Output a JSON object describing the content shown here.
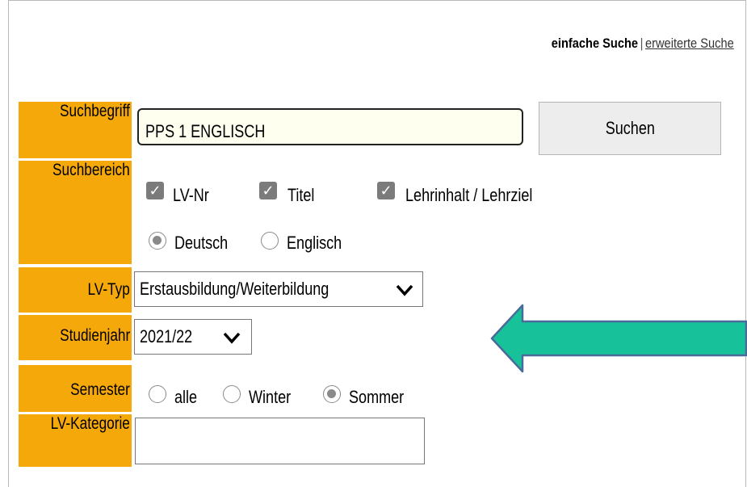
{
  "top_links": {
    "simple_search": "einfache Suche",
    "separator": "|",
    "advanced_search": "erweiterte Suche"
  },
  "labels": {
    "suchbegriff": "Suchbegriff",
    "suchbereich": "Suchbereich",
    "lv_typ": "LV-Typ",
    "studienjahr": "Studienjahr",
    "semester": "Semester",
    "lv_kategorie": "LV-Kategorie"
  },
  "search": {
    "value": "PPS 1 ENGLISCH",
    "button_label": "Suchen"
  },
  "suchbereich": {
    "checkboxes": [
      {
        "label": "LV-Nr",
        "checked": true
      },
      {
        "label": "Titel",
        "checked": true
      },
      {
        "label": "Lehrinhalt / Lehrziel",
        "checked": true
      }
    ],
    "language": [
      {
        "label": "Deutsch",
        "selected": true
      },
      {
        "label": "Englisch",
        "selected": false
      }
    ]
  },
  "lv_typ": {
    "selected": "Erstausbildung/Weiterbildung"
  },
  "studienjahr": {
    "selected": "2021/22"
  },
  "semester": [
    {
      "label": "alle",
      "selected": false
    },
    {
      "label": "Winter",
      "selected": false
    },
    {
      "label": "Sommer",
      "selected": true
    }
  ],
  "lv_kategorie": {
    "value": ""
  },
  "colors": {
    "label_bg": "#f4a80a",
    "input_bg": "#fffff0",
    "arrow_fill": "#17c29a",
    "arrow_stroke": "#4a6b9a",
    "control_grey": "#7b7b7b"
  },
  "icons": {
    "checkbox": "check-icon",
    "dropdown": "chevron-down-icon",
    "annotation": "left-arrow-icon"
  }
}
